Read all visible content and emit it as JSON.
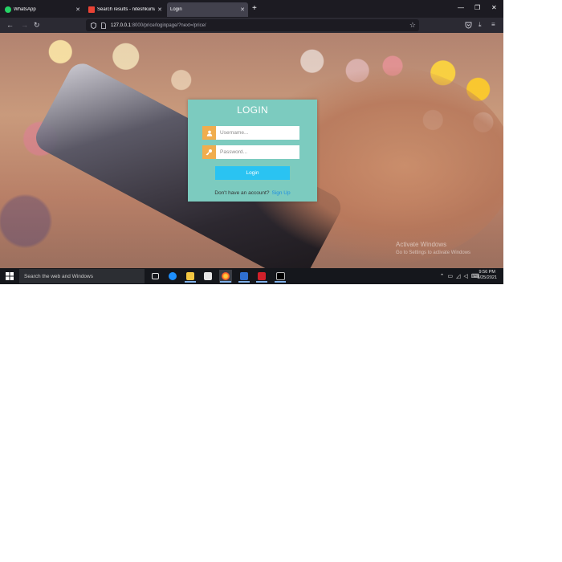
{
  "browser": {
    "tabs": [
      {
        "title": "WhatsApp",
        "favicon_color": "#25d366",
        "active": false
      },
      {
        "title": "Search results - niteshkumar@...",
        "favicon_color": "#ea4335",
        "active": false
      },
      {
        "title": "Login",
        "favicon_color": "",
        "active": true
      }
    ],
    "url_host": "127.0.0.1",
    "url_rest": ":8000/price/loginpage/?next=/price/"
  },
  "login": {
    "title": "LOGIN",
    "username_placeholder": "Username...",
    "password_placeholder": "Password...",
    "login_button": "Login",
    "signup_prompt": "Don't have an account?",
    "signup_link": "Sign Up",
    "card_color": "#7ccbbf",
    "icon_color": "#f0ad4e",
    "button_color": "#2ac3f2"
  },
  "watermark": {
    "title": "Activate Windows",
    "subtitle": "Go to Settings to activate Windows"
  },
  "taskbar": {
    "search_placeholder": "Search the web and Windows",
    "time": "9:56 PM",
    "date": "5/25/2021",
    "apps": [
      "task-view-icon",
      "edge-icon",
      "file-explorer-icon",
      "store-icon",
      "firefox-icon",
      "outlook-icon",
      "acrobat-icon",
      "terminal-icon"
    ]
  }
}
